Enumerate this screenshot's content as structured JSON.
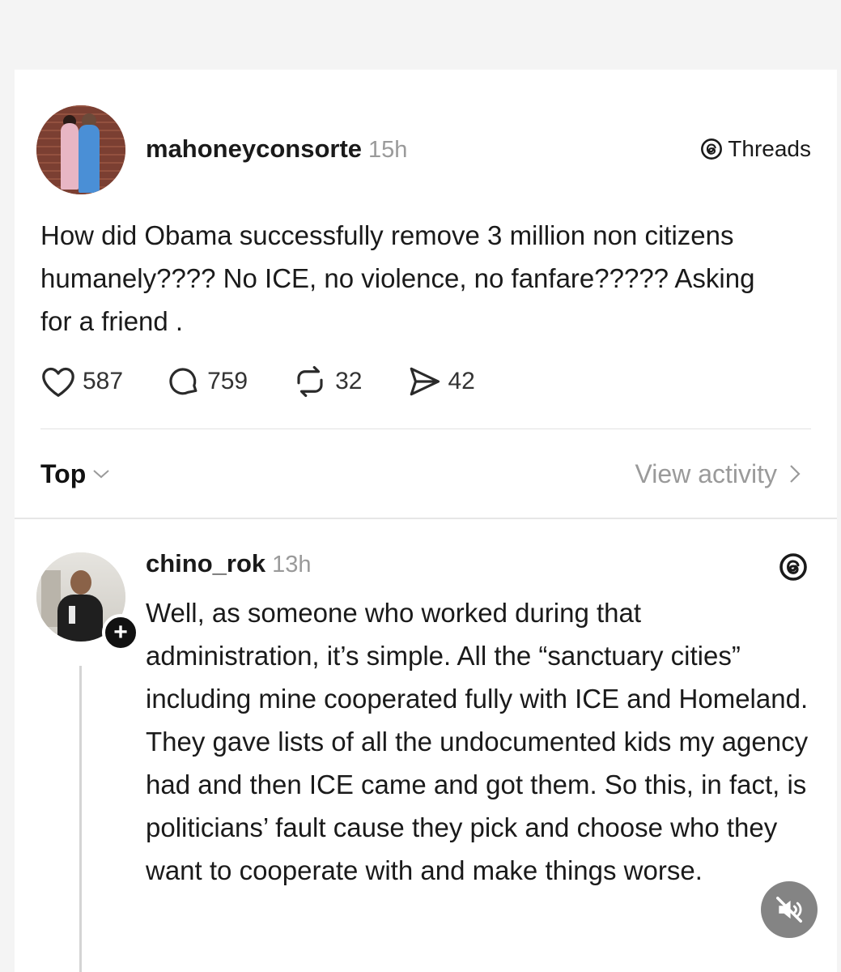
{
  "post": {
    "username": "mahoneyconsorte",
    "time": "15h",
    "source_label": "Threads",
    "text": "How did Obama successfully remove 3 million non citizens humanely???? No ICE, no violence, no fanfare????? Asking for a friend .",
    "actions": {
      "likes": "587",
      "comments": "759",
      "reposts": "32",
      "shares": "42"
    },
    "icons": [
      "heart-icon",
      "comment-icon",
      "repost-icon",
      "share-icon",
      "threads-logo-icon"
    ]
  },
  "sort": {
    "label": "Top",
    "view_activity": "View activity"
  },
  "reply": {
    "username": "chino_rok",
    "time": "13h",
    "follow_symbol": "+",
    "text": "Well, as someone who worked during that administration, it’s simple. All the “sanctuary cities” including mine cooperated fully with ICE and Homeland. They gave lists of all the undocumented kids my agency had and then ICE came and got them. So this, in fact, is politicians’ fault cause they pick and choose who they want to cooperate with and make things worse."
  },
  "colors": {
    "text": "#1a1a1a",
    "muted": "#9a9a9a",
    "divider": "#e2e2e2",
    "background": "#ffffff"
  }
}
